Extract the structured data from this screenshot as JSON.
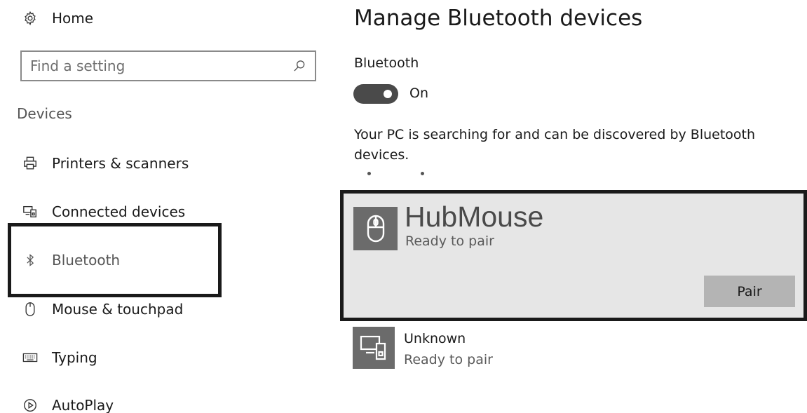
{
  "nav": {
    "home_label": "Home",
    "search": {
      "placeholder": "Find a setting",
      "value": ""
    },
    "section_heading": "Devices",
    "items": [
      {
        "label": "Printers & scanners",
        "icon": "printer-icon"
      },
      {
        "label": "Connected devices",
        "icon": "connected-devices-icon"
      },
      {
        "label": "Bluetooth",
        "icon": "bluetooth-icon",
        "selected": true
      },
      {
        "label": "Mouse & touchpad",
        "icon": "mouse-icon"
      },
      {
        "label": "Typing",
        "icon": "keyboard-icon"
      },
      {
        "label": "AutoPlay",
        "icon": "autoplay-icon"
      }
    ]
  },
  "main": {
    "title": "Manage Bluetooth devices",
    "bluetooth_label": "Bluetooth",
    "toggle": {
      "state": "On",
      "on": true
    },
    "searching_text": "Your PC is searching for and can be discovered by Bluetooth devices.",
    "devices": [
      {
        "name": "HubMouse",
        "status": "Ready to pair",
        "icon": "mouse-icon",
        "selected": true,
        "action_label": "Pair"
      },
      {
        "name": "Unknown",
        "status": "Ready to pair",
        "icon": "devices-icon"
      }
    ]
  },
  "colors": {
    "toggle_on": "#4a4a4a",
    "selected_card_bg": "#e6e6e6",
    "pair_button_bg": "#b4b4b4",
    "device_tile_bg": "#6b6b6b",
    "highlight_border": "#1a1a1a"
  }
}
